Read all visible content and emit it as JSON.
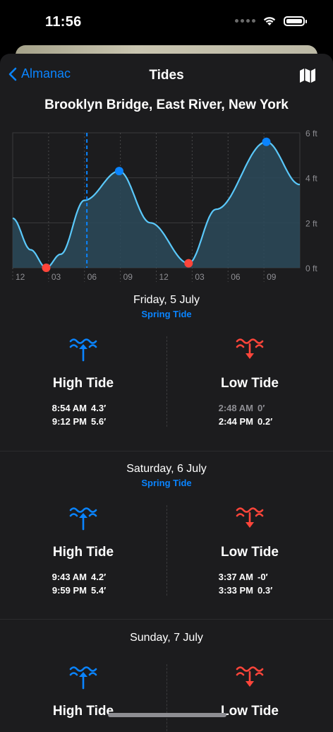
{
  "status": {
    "time": "11:56"
  },
  "nav": {
    "back_label": "Almanac",
    "title": "Tides"
  },
  "location": "Brooklyn Bridge, East River, New York",
  "chart_data": {
    "type": "area",
    "title": "",
    "xlabel": "",
    "ylabel": "",
    "x_tick_labels": [
      "12",
      "03",
      "06",
      "09",
      "12",
      "03",
      "06",
      "09"
    ],
    "y_tick_labels": [
      "6 ft",
      "4 ft",
      "2 ft",
      "0 ft"
    ],
    "ylim": [
      0,
      6
    ],
    "x_hours_range": [
      0,
      24
    ],
    "series": [
      {
        "x": [
          0,
          1.5,
          2.8,
          4.0,
          6.0,
          8.9,
          11.5,
          14.7,
          17.0,
          21.2,
          24.0
        ],
        "y": [
          2.2,
          0.8,
          0.0,
          0.6,
          3.0,
          4.3,
          2.0,
          0.2,
          2.6,
          5.6,
          3.7
        ]
      }
    ],
    "current_time_hour": 6.2,
    "high_points": [
      {
        "x": 8.9,
        "y": 4.3
      },
      {
        "x": 21.2,
        "y": 5.6
      }
    ],
    "low_points": [
      {
        "x": 2.8,
        "y": 0.0
      },
      {
        "x": 14.7,
        "y": 0.2
      }
    ],
    "grid": true
  },
  "days": [
    {
      "title": "Friday, 5 July",
      "subtitle": "Spring Tide",
      "high_label": "High Tide",
      "low_label": "Low Tide",
      "high": [
        {
          "time": "8:54 AM",
          "height": "4.3′"
        },
        {
          "time": "9:12 PM",
          "height": "5.6′"
        }
      ],
      "low": [
        {
          "time": "2:48 AM",
          "height": "0′"
        },
        {
          "time": "2:44 PM",
          "height": "0.2′"
        }
      ]
    },
    {
      "title": "Saturday, 6 July",
      "subtitle": "Spring Tide",
      "high_label": "High Tide",
      "low_label": "Low Tide",
      "high": [
        {
          "time": "9:43 AM",
          "height": "4.2′"
        },
        {
          "time": "9:59 PM",
          "height": "5.4′"
        }
      ],
      "low": [
        {
          "time": "3:37 AM",
          "height": "-0′"
        },
        {
          "time": "3:33 PM",
          "height": "0.3′"
        }
      ]
    },
    {
      "title": "Sunday, 7 July",
      "high_label": "High Tide",
      "low_label": "Low Tide"
    }
  ],
  "colors": {
    "accent": "#0a84ff",
    "low": "#ff453a",
    "curve": "#5ac8fa",
    "fill": "#2c4a5a"
  }
}
